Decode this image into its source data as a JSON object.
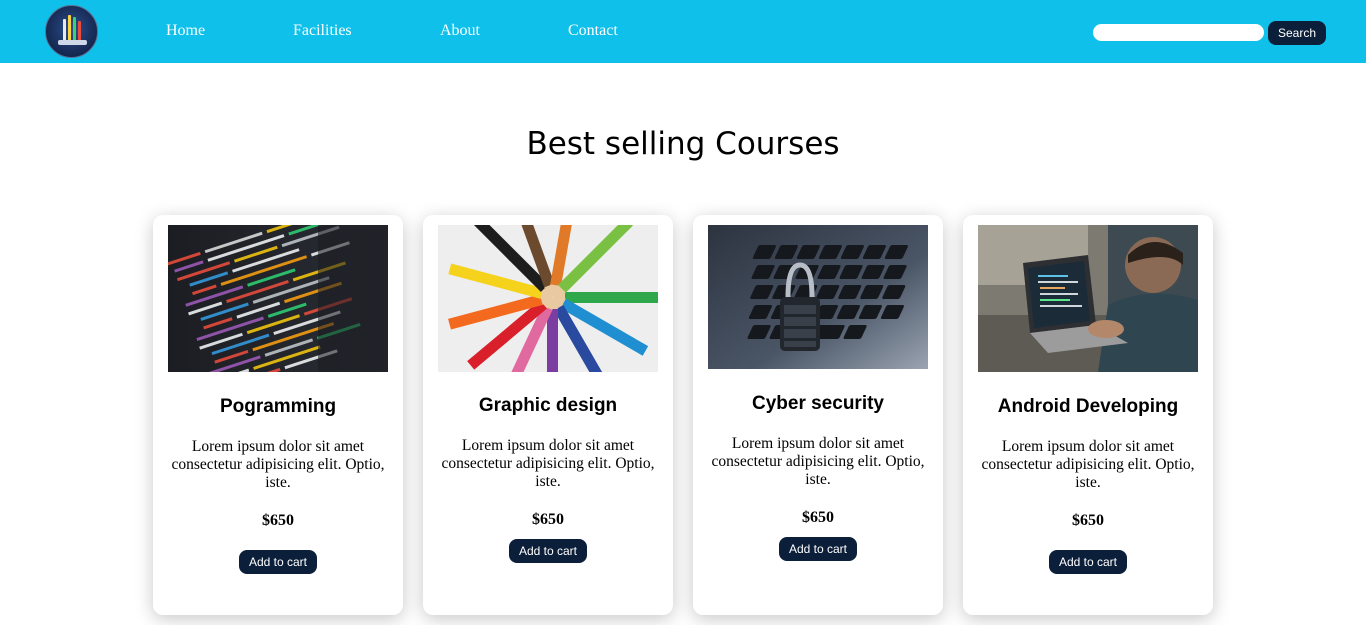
{
  "nav": {
    "links": [
      "Home",
      "Facilities",
      "About",
      "Contact"
    ],
    "search_placeholder": "",
    "search_label": "Search"
  },
  "section_title": "Best selling Courses",
  "courses": [
    {
      "title": "Pogramming",
      "description": "Lorem ipsum dolor sit amet consectetur adipisicing elit. Optio, iste.",
      "price": "$650",
      "button": "Add to cart",
      "image": "code-screen-photo"
    },
    {
      "title": "Graphic design",
      "description": "Lorem ipsum dolor sit amet consectetur adipisicing elit. Optio, iste.",
      "price": "$650",
      "button": "Add to cart",
      "image": "colored-pencils-photo"
    },
    {
      "title": "Cyber security",
      "description": "Lorem ipsum dolor sit amet consectetur adipisicing elit. Optio, iste.",
      "price": "$650",
      "button": "Add to cart",
      "image": "padlock-keyboard-photo"
    },
    {
      "title": "Android Developing",
      "description": "Lorem ipsum dolor sit amet consectetur adipisicing elit. Optio, iste.",
      "price": "$650",
      "button": "Add to cart",
      "image": "developer-laptop-photo"
    }
  ],
  "colors": {
    "navbar": "#0fc0ea",
    "button": "#0c1f3a"
  }
}
